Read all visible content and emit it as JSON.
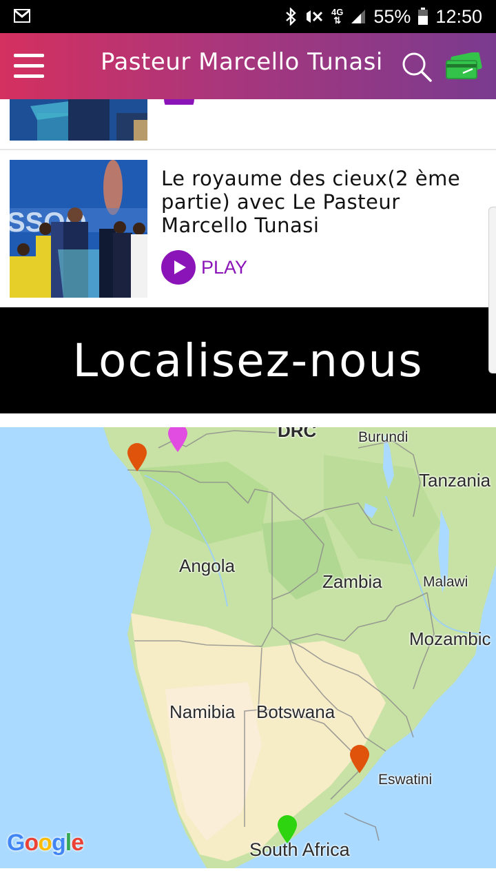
{
  "status_bar": {
    "battery": "55%",
    "time": "12:50",
    "network": "4G",
    "icons": [
      "gmail-icon",
      "bluetooth-icon",
      "vibrate-off-icon",
      "network-4g-icon",
      "signal-icon",
      "battery-icon"
    ]
  },
  "app_bar": {
    "title": "Pasteur Marcello Tunasi",
    "icons": [
      "menu-icon",
      "search-icon",
      "payment-card-icon"
    ],
    "colors": {
      "gradient_start": "#d4305f",
      "gradient_end": "#7a3b8f",
      "cart_icon": "#33c24a"
    }
  },
  "media_list": {
    "items": [
      {
        "title": "Le royaume des cieux(2 ème partie) avec Le Pasteur Marcello Tunasi",
        "play_label": "PLAY"
      }
    ],
    "accent_color": "#8b14b8"
  },
  "location_section": {
    "heading": "Localisez-nous"
  },
  "map": {
    "labels": {
      "drc": "DRC",
      "burundi": "Burundi",
      "tanzania": "Tanzania",
      "angola": "Angola",
      "zambia": "Zambia",
      "malawi": "Malawi",
      "mozambique": "Mozambic",
      "namibia": "Namibia",
      "botswana": "Botswana",
      "eswatini": "Eswatini",
      "south_africa": "South Africa"
    },
    "attribution": "Google",
    "pin_colors": [
      "#e0530a",
      "#e04de0",
      "#e0530a",
      "#2dd40f"
    ]
  }
}
